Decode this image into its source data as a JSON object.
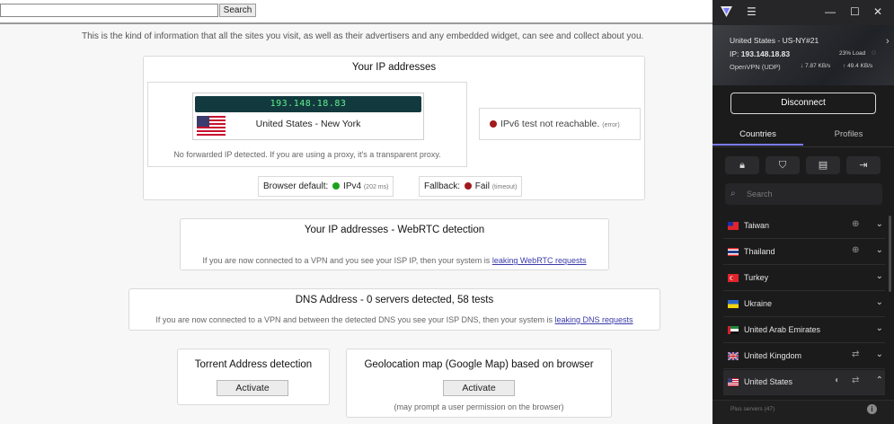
{
  "web": {
    "search_button": "Search",
    "intro": "This is the kind of information that all the sites you visit, as well as their advertisers and any embedded widget, can see and collect about you.",
    "ip_panel": {
      "title": "Your IP addresses",
      "ip": "193.148.18.83",
      "country": "United States - New York",
      "forward_note": "No forwarded IP detected. If you are using a proxy, it's a transparent proxy.",
      "ipv6_text": "IPv6 test not reachable.",
      "ipv6_error": "(error)",
      "browser_default_label": "Browser default:",
      "browser_default_value": "IPv4",
      "browser_default_time": "(202 ms)",
      "fallback_label": "Fallback:",
      "fallback_value": "Fail",
      "fallback_time": "(timeout)"
    },
    "webrtc": {
      "title": "Your IP addresses - WebRTC detection",
      "note": "If you are now connected to a VPN and you see your ISP IP, then your system is",
      "link": "leaking WebRTC requests"
    },
    "dns": {
      "title": "DNS Address - 0 servers detected, 58 tests",
      "note": "If you are now connected to a VPN and between the detected DNS you see your ISP DNS, then your system is",
      "link": "leaking DNS requests"
    },
    "torrent": {
      "title": "Torrent Address detection",
      "button": "Activate"
    },
    "geo": {
      "title": "Geolocation map (Google Map) based on browser",
      "button": "Activate",
      "note": "(may prompt a user permission on the browser)"
    },
    "colors": {
      "ok_dot": "#1aa31a",
      "fail_dot": "#a31a1a",
      "ip_text": "#5ff08c",
      "ip_bg": "#123a3e"
    }
  },
  "vpn": {
    "server": "United States - US-NY#21",
    "ip_label": "IP:",
    "ip": "193.148.18.83",
    "load": "23% Load",
    "protocol": "OpenVPN (UDP)",
    "down": "7.87 KB/s",
    "up": "49.4 KB/s",
    "disconnect": "Disconnect",
    "tabs": [
      "Countries",
      "Profiles"
    ],
    "search_placeholder": "Search",
    "countries": [
      {
        "name": "Taiwan"
      },
      {
        "name": "Thailand"
      },
      {
        "name": "Turkey"
      },
      {
        "name": "Ukraine"
      },
      {
        "name": "United Arab Emirates"
      },
      {
        "name": "United Kingdom"
      },
      {
        "name": "United States"
      }
    ],
    "footer": "Plus servers (47)",
    "accent": "#7b7bff"
  }
}
